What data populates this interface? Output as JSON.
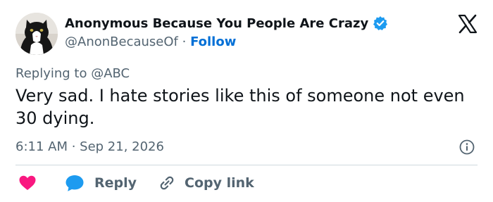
{
  "author": {
    "display_name": "Anonymous Because You People Are Crazy",
    "handle": "@AnonBecauseOf",
    "separator": "·",
    "follow_label": "Follow",
    "verified": true,
    "avatar": "black-and-white-cat-photo"
  },
  "brand": {
    "logo": "x-logo-icon"
  },
  "tweet": {
    "replying_to": "Replying to @ABC",
    "text": "Very sad. I hate stories like this of someone not even 30 dying.",
    "timestamp": "6:11 AM · Sep 21, 2026"
  },
  "actions": {
    "like_icon": "heart-icon",
    "reply_label": "Reply",
    "copy_link_label": "Copy link"
  },
  "colors": {
    "verified_blue": "#1d9bf0",
    "follow_blue": "#006fd6",
    "heart_pink": "#f91880",
    "secondary_text": "#536471"
  }
}
